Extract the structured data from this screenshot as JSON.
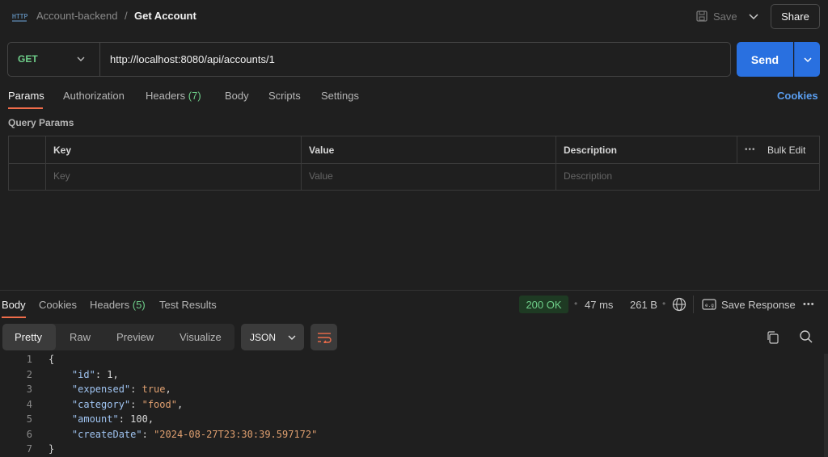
{
  "breadcrumb": {
    "parent": "Account-backend",
    "separator": "/",
    "current": "Get Account"
  },
  "toolbar": {
    "save_label": "Save",
    "share_label": "Share"
  },
  "request": {
    "method": "GET",
    "url": "http://localhost:8080/api/accounts/1",
    "send_label": "Send"
  },
  "request_tabs": {
    "params": "Params",
    "authorization": "Authorization",
    "headers": "Headers",
    "headers_count": "(7)",
    "body": "Body",
    "scripts": "Scripts",
    "settings": "Settings",
    "cookies": "Cookies"
  },
  "query_params": {
    "title": "Query Params",
    "headers": {
      "key": "Key",
      "value": "Value",
      "description": "Description"
    },
    "bulk_edit": "Bulk Edit",
    "placeholders": {
      "key": "Key",
      "value": "Value",
      "description": "Description"
    }
  },
  "response_tabs": {
    "body": "Body",
    "cookies": "Cookies",
    "headers": "Headers",
    "headers_count": "(5)",
    "test_results": "Test Results"
  },
  "response_meta": {
    "status": "200 OK",
    "time": "47 ms",
    "size": "261 B",
    "save_response": "Save Response",
    "separator": "•"
  },
  "format": {
    "pretty": "Pretty",
    "raw": "Raw",
    "preview": "Preview",
    "visualize": "Visualize",
    "language": "JSON"
  },
  "code_lines": [
    {
      "n": "1",
      "text": "{"
    },
    {
      "n": "2",
      "key": "\"id\"",
      "val": "1",
      "type": "n"
    },
    {
      "n": "3",
      "key": "\"expensed\"",
      "val": "true",
      "type": "b"
    },
    {
      "n": "4",
      "key": "\"category\"",
      "val": "\"food\"",
      "type": "s"
    },
    {
      "n": "5",
      "key": "\"amount\"",
      "val": "100",
      "type": "n"
    },
    {
      "n": "6",
      "key": "\"createDate\"",
      "val": "\"2024-08-27T23:30:39.597172\"",
      "type": "s",
      "last": true
    },
    {
      "n": "7",
      "text": "}"
    }
  ],
  "colors": {
    "accent": "#ef6c4a",
    "send": "#2970e0",
    "method": "#6fcf8a",
    "status_bg": "#1e3a23",
    "link": "#5a9ef0"
  }
}
